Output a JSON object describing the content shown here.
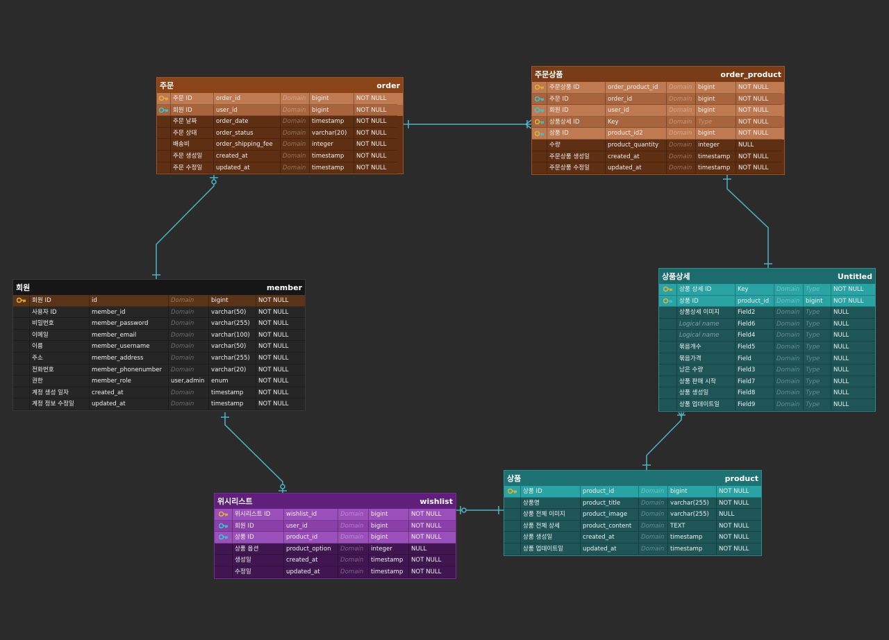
{
  "colors": {
    "background": "#2b2b2b",
    "connector": "#4fb4c6",
    "order_theme": "#8a4418",
    "member_theme": "#1a1a1a",
    "wishlist_theme": "#5a1c73",
    "product_theme": "#1d5f61",
    "product_detail_theme": "#1c6264"
  },
  "tables": {
    "order": {
      "name": "주문",
      "physical": "order",
      "rows": [
        {
          "key": "pk",
          "logical": "주문 ID",
          "physical": "order_id",
          "domain": "Domain",
          "type": "bigint",
          "nullable": "NOT NULL"
        },
        {
          "key": "fk",
          "logical": "회원 ID",
          "physical": "user_id",
          "domain": "Domain",
          "type": "bigint",
          "nullable": "NOT NULL"
        },
        {
          "key": "",
          "logical": "주문 날짜",
          "physical": "order_date",
          "domain": "Domain",
          "type": "timestamp",
          "nullable": "NOT NULL"
        },
        {
          "key": "",
          "logical": "주문 상태",
          "physical": "order_status",
          "domain": "Domain",
          "type": "varchar(20)",
          "nullable": "NOT NULL"
        },
        {
          "key": "",
          "logical": "배송비",
          "physical": "order_shipping_fee",
          "domain": "Domain",
          "type": "integer",
          "nullable": "NOT NULL"
        },
        {
          "key": "",
          "logical": "주문 생성일",
          "physical": "created_at",
          "domain": "Domain",
          "type": "timestamp",
          "nullable": "NOT NULL"
        },
        {
          "key": "",
          "logical": "주문 수정일",
          "physical": "updated_at",
          "domain": "Domain",
          "type": "timestamp",
          "nullable": "NOT NULL"
        }
      ]
    },
    "order_product": {
      "name": "주문상품",
      "physical": "order_product",
      "rows": [
        {
          "key": "pk",
          "logical": "주문상품 ID",
          "physical": "order_product_id",
          "domain": "Domain",
          "type": "bigint",
          "nullable": "NOT NULL"
        },
        {
          "key": "fk",
          "logical": "주문 ID",
          "physical": "order_id",
          "domain": "Domain",
          "type": "bigint",
          "nullable": "NOT NULL"
        },
        {
          "key": "fk",
          "logical": "회원 ID",
          "physical": "user_id",
          "domain": "Domain",
          "type": "bigint",
          "nullable": "NOT NULL"
        },
        {
          "key": "pfk",
          "logical": "상품상세 ID",
          "physical": "Key",
          "domain": "Domain",
          "type": "Type",
          "nullable": "NOT NULL"
        },
        {
          "key": "pfk",
          "logical": "상품 ID",
          "physical": "product_id2",
          "domain": "Domain",
          "type": "bigint",
          "nullable": "NOT NULL"
        },
        {
          "key": "",
          "logical": "수량",
          "physical": "product_quantity",
          "domain": "Domain",
          "type": "integer",
          "nullable": "NULL"
        },
        {
          "key": "",
          "logical": "주문상품 생성일",
          "physical": "created_at",
          "domain": "Domain",
          "type": "timestamp",
          "nullable": "NOT NULL"
        },
        {
          "key": "",
          "logical": "주문상품 수정일",
          "physical": "updated_at",
          "domain": "Domain",
          "type": "timestamp",
          "nullable": "NOT NULL"
        }
      ]
    },
    "member": {
      "name": "회원",
      "physical": "member",
      "rows": [
        {
          "key": "pk",
          "logical": "회원 ID",
          "physical": "id",
          "domain": "Domain",
          "type": "bigint",
          "nullable": "NOT NULL"
        },
        {
          "key": "",
          "logical": "사용자 ID",
          "physical": "member_id",
          "domain": "Domain",
          "type": "varchar(50)",
          "nullable": "NOT NULL"
        },
        {
          "key": "",
          "logical": "비밀번호",
          "physical": "member_password",
          "domain": "Domain",
          "type": "varchar(255)",
          "nullable": "NOT NULL"
        },
        {
          "key": "",
          "logical": "이메일",
          "physical": "member_email",
          "domain": "Domain",
          "type": "varchar(100)",
          "nullable": "NOT NULL"
        },
        {
          "key": "",
          "logical": "이름",
          "physical": "member_username",
          "domain": "Domain",
          "type": "varchar(50)",
          "nullable": "NOT NULL"
        },
        {
          "key": "",
          "logical": "주소",
          "physical": "member_address",
          "domain": "Domain",
          "type": "varchar(255)",
          "nullable": "NOT NULL"
        },
        {
          "key": "",
          "logical": "전화번호",
          "physical": "member_phonenumber",
          "domain": "Domain",
          "type": "varchar(20)",
          "nullable": "NOT NULL"
        },
        {
          "key": "",
          "logical": "권한",
          "physical": "member_role",
          "domain": "user,admin",
          "type": "enum",
          "nullable": "NOT NULL"
        },
        {
          "key": "",
          "logical": "계정 생성 일자",
          "physical": "created_at",
          "domain": "Domain",
          "type": "timestamp",
          "nullable": "NOT NULL"
        },
        {
          "key": "",
          "logical": "계정 정보 수정일",
          "physical": "updated_at",
          "domain": "Domain",
          "type": "timestamp",
          "nullable": "NOT NULL"
        }
      ]
    },
    "product_detail": {
      "name": "상품상세",
      "physical": "Untitled",
      "rows": [
        {
          "key": "pk",
          "logical": "상품 상세 ID",
          "physical": "Key",
          "domain": "Domain",
          "type": "Type",
          "nullable": "NOT NULL"
        },
        {
          "key": "pfk",
          "logical": "상품 ID",
          "physical": "product_id",
          "domain": "Domain",
          "type": "bigint",
          "nullable": "NOT NULL"
        },
        {
          "key": "",
          "logical": "상품상세 이미지",
          "physical": "Field2",
          "domain": "Domain",
          "type": "Type",
          "nullable": "NULL"
        },
        {
          "key": "",
          "logical": "Logical name",
          "physical": "Field6",
          "domain": "Domain",
          "type": "Type",
          "nullable": "NULL"
        },
        {
          "key": "",
          "logical": "Logical name",
          "physical": "Field4",
          "domain": "Domain",
          "type": "Type",
          "nullable": "NULL"
        },
        {
          "key": "",
          "logical": "묶음개수",
          "physical": "Field5",
          "domain": "Domain",
          "type": "Type",
          "nullable": "NULL"
        },
        {
          "key": "",
          "logical": "묶음가격",
          "physical": "Field",
          "domain": "Domain",
          "type": "Type",
          "nullable": "NULL"
        },
        {
          "key": "",
          "logical": "남은 수량",
          "physical": "Field3",
          "domain": "Domain",
          "type": "Type",
          "nullable": "NULL"
        },
        {
          "key": "",
          "logical": "상품 판매 시작",
          "physical": "Field7",
          "domain": "Domain",
          "type": "Type",
          "nullable": "NULL"
        },
        {
          "key": "",
          "logical": "상품 생성일",
          "physical": "Field8",
          "domain": "Domain",
          "type": "Type",
          "nullable": "NULL"
        },
        {
          "key": "",
          "logical": "상품 업데이트일",
          "physical": "Field9",
          "domain": "Domain",
          "type": "Type",
          "nullable": "NULL"
        }
      ]
    },
    "product": {
      "name": "상품",
      "physical": "product",
      "rows": [
        {
          "key": "pk",
          "logical": "상품 ID",
          "physical": "product_id",
          "domain": "Domain",
          "type": "bigint",
          "nullable": "NOT NULL"
        },
        {
          "key": "",
          "logical": "상품명",
          "physical": "product_title",
          "domain": "Domain",
          "type": "varchar(255)",
          "nullable": "NOT NULL"
        },
        {
          "key": "",
          "logical": "상품 전체 이미지",
          "physical": "product_image",
          "domain": "Domain",
          "type": "varchar(255)",
          "nullable": "NULL"
        },
        {
          "key": "",
          "logical": "상품 전체 상세",
          "physical": "product_content",
          "domain": "Domain",
          "type": "TEXT",
          "nullable": "NOT NULL"
        },
        {
          "key": "",
          "logical": "상품 생성일",
          "physical": "created_at",
          "domain": "Domain",
          "type": "timestamp",
          "nullable": "NOT NULL"
        },
        {
          "key": "",
          "logical": "상품 업데이트일",
          "physical": "updated_at",
          "domain": "Domain",
          "type": "timestamp",
          "nullable": "NOT NULL"
        }
      ]
    },
    "wishlist": {
      "name": "위시리스트",
      "physical": "wishlist",
      "rows": [
        {
          "key": "pk",
          "logical": "위시리스트 ID",
          "physical": "wishlist_id",
          "domain": "Domain",
          "type": "bigint",
          "nullable": "NOT NULL"
        },
        {
          "key": "fk",
          "logical": "회원 ID",
          "physical": "user_id",
          "domain": "Domain",
          "type": "bigint",
          "nullable": "NOT NULL"
        },
        {
          "key": "fk",
          "logical": "상품 ID",
          "physical": "product_id",
          "domain": "Domain",
          "type": "bigint",
          "nullable": "NOT NULL"
        },
        {
          "key": "",
          "logical": "상품 옵션",
          "physical": "product_option",
          "domain": "Domain",
          "type": "integer",
          "nullable": "NULL"
        },
        {
          "key": "",
          "logical": "생성일",
          "physical": "created_at",
          "domain": "Domain",
          "type": "timestamp",
          "nullable": "NOT NULL"
        },
        {
          "key": "",
          "logical": "수정일",
          "physical": "updated_at",
          "domain": "Domain",
          "type": "timestamp",
          "nullable": "NOT NULL"
        }
      ]
    }
  }
}
